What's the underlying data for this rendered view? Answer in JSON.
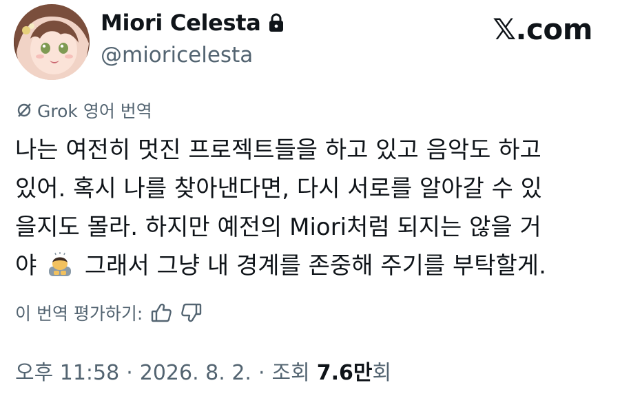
{
  "user": {
    "display_name": "Miori Celesta",
    "handle": "@mioricelesta",
    "protected_icon": "lock-icon",
    "avatar_icon": "anime-girl-avatar"
  },
  "brand": "𝕏.com",
  "translation": {
    "icon": "grok-icon",
    "label": "Grok 영어 번역"
  },
  "tweet": {
    "line1": "나는 여전히 멋진 프로젝트들을 하고 있고 음악도 하고",
    "line2": "있어. 혹시 나를 찾아낸다면, 다시 서로를 알아갈 수 있",
    "line3": "을지도 몰라. 하지만 예전의 Miori처럼 되지는 않을 거",
    "line4_a": "야",
    "line4_emoji": "person-bowing-emoji",
    "line4_b": "그래서 그냥 내 경계를 존중해 주기를 부탁할게."
  },
  "rating": {
    "label": "이 번역 평가하기:",
    "thumbs_up_icon": "thumbs-up-icon",
    "thumbs_down_icon": "thumbs-down-icon"
  },
  "meta": {
    "time": "오후 11:58",
    "sep1": "·",
    "date": "2026. 8. 2.",
    "sep2": "·",
    "views_label": "조회",
    "views_count": "7.6만",
    "views_suffix": "회"
  },
  "colors": {
    "text": "#0f1419",
    "secondary": "#536471"
  }
}
